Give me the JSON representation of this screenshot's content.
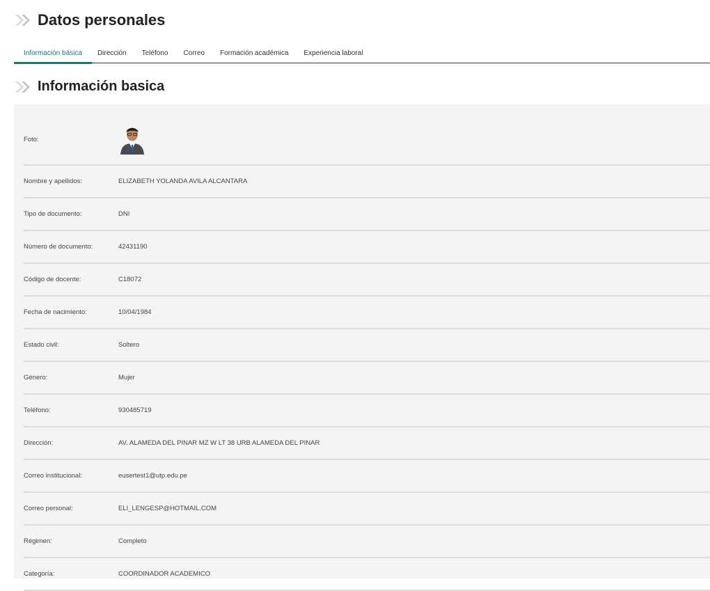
{
  "header": {
    "title": "Datos personales"
  },
  "tabs": [
    {
      "label": "Información básica",
      "active": true
    },
    {
      "label": "Dirección",
      "active": false
    },
    {
      "label": "Teléfono",
      "active": false
    },
    {
      "label": "Correo",
      "active": false
    },
    {
      "label": "Formación académica",
      "active": false
    },
    {
      "label": "Experiencia laboral",
      "active": false
    }
  ],
  "section": {
    "title": "Información basica"
  },
  "profile": {
    "photo_label": "Foto:",
    "fields": [
      {
        "label": "Nombre y apellidos:",
        "value": "ELIZABETH YOLANDA AVILA ALCANTARA"
      },
      {
        "label": "Tipo de documento:",
        "value": "DNI"
      },
      {
        "label": "Número de documento:",
        "value": "42431190"
      },
      {
        "label": "Código de docente:",
        "value": "C18072"
      },
      {
        "label": "Fecha de nacimiento:",
        "value": "10/04/1984"
      },
      {
        "label": "Estado civil:",
        "value": "Soltero"
      },
      {
        "label": "Género:",
        "value": "Mujer"
      },
      {
        "label": "Teléfono:",
        "value": "930485719"
      },
      {
        "label": "Dirección:",
        "value": "AV. ALAMEDA DEL PINAR MZ W LT 38 URB ALAMEDA DEL PINAR"
      },
      {
        "label": "Correo institucional:",
        "value": "eusertest1@utp.edu.pe"
      },
      {
        "label": "Correo personal:",
        "value": "ELI_LENGESP@HOTMAIL.COM"
      },
      {
        "label": "Régimen:",
        "value": "Completo"
      },
      {
        "label": "Categoría:",
        "value": "COORDINADOR ACADEMICO"
      }
    ]
  },
  "colors": {
    "accent": "#1a7a6e",
    "card_bg": "#f4f4f4",
    "divider": "#dcdcdc"
  },
  "icons": {
    "title": "double-chevron-icon",
    "avatar": "user-photo"
  }
}
